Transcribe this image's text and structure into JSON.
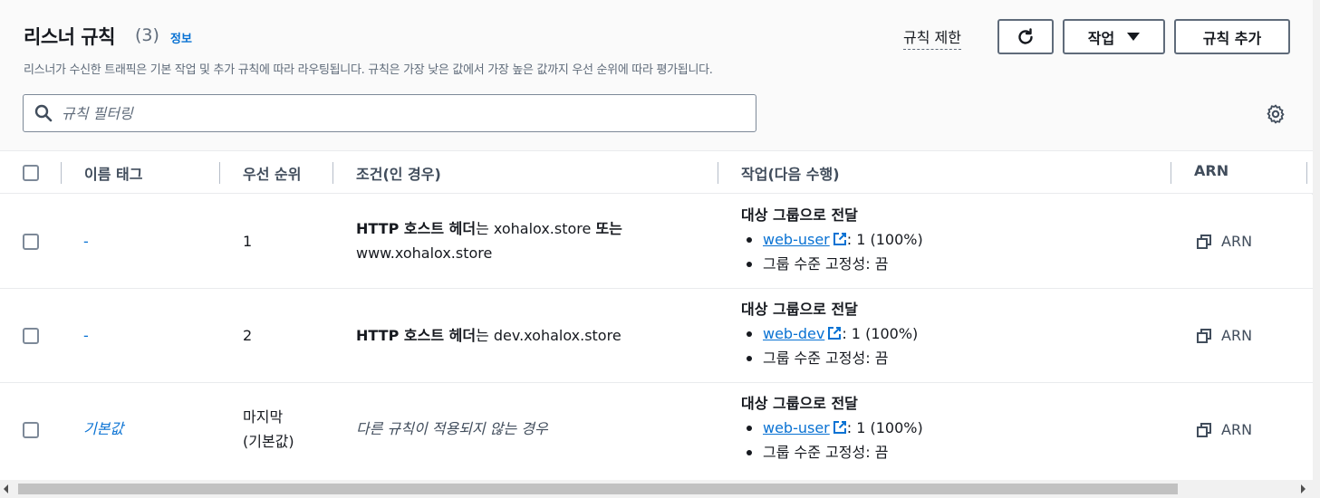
{
  "header": {
    "title": "리스너 규칙",
    "count": "(3)",
    "info_link": "정보",
    "description": "리스너가 수신한 트래픽은 기본 작업 및 추가 규칙에 따라 라우팅됩니다. 규칙은 가장 낮은 값에서 가장 높은 값까지 우선 순위에 따라 평가됩니다.",
    "limit_link": "규칙 제한",
    "action_button": "작업",
    "add_button": "규칙 추가"
  },
  "search": {
    "placeholder": "규칙 필터링",
    "value": ""
  },
  "table": {
    "columns": [
      "이름 태그",
      "우선 순위",
      "조건(인 경우)",
      "작업(다음 수행)",
      "ARN"
    ],
    "rows": [
      {
        "name": "-",
        "priority": "1",
        "condition_bold": "HTTP 호스트 헤더",
        "condition_text": "는 xohalox.store ",
        "condition_bold2": "또는",
        "condition_text2": "www.xohalox.store",
        "action_title": "대상 그룹으로 전달",
        "target_group": "web-user",
        "target_weight": ": 1 (100%)",
        "stickiness": "그룹 수준 고정성: 끔",
        "arn": "ARN"
      },
      {
        "name": "-",
        "priority": "2",
        "condition_bold": "HTTP 호스트 헤더",
        "condition_text": "는 dev.xohalox.store",
        "action_title": "대상 그룹으로 전달",
        "target_group": "web-dev",
        "target_weight": ": 1 (100%)",
        "stickiness": "그룹 수준 고정성: 끔",
        "arn": "ARN"
      },
      {
        "name": "기본값",
        "priority_line1": "마지막",
        "priority_line2": "(기본값)",
        "condition_italic": "다른 규칙이 적용되지 않는 경우",
        "action_title": "대상 그룹으로 전달",
        "target_group": "web-user",
        "target_weight": ": 1 (100%)",
        "stickiness": "그룹 수준 고정성: 끔",
        "arn": "ARN"
      }
    ]
  },
  "icons": {
    "refresh": "refresh-icon",
    "caret": "caret-down-icon",
    "search": "search-icon",
    "settings": "gear-icon",
    "external": "external-link-icon",
    "copy": "copy-icon"
  },
  "colors": {
    "link": "#0972d3",
    "text": "#16191f",
    "muted": "#5f6b7a",
    "header_bg": "#fafafa"
  }
}
